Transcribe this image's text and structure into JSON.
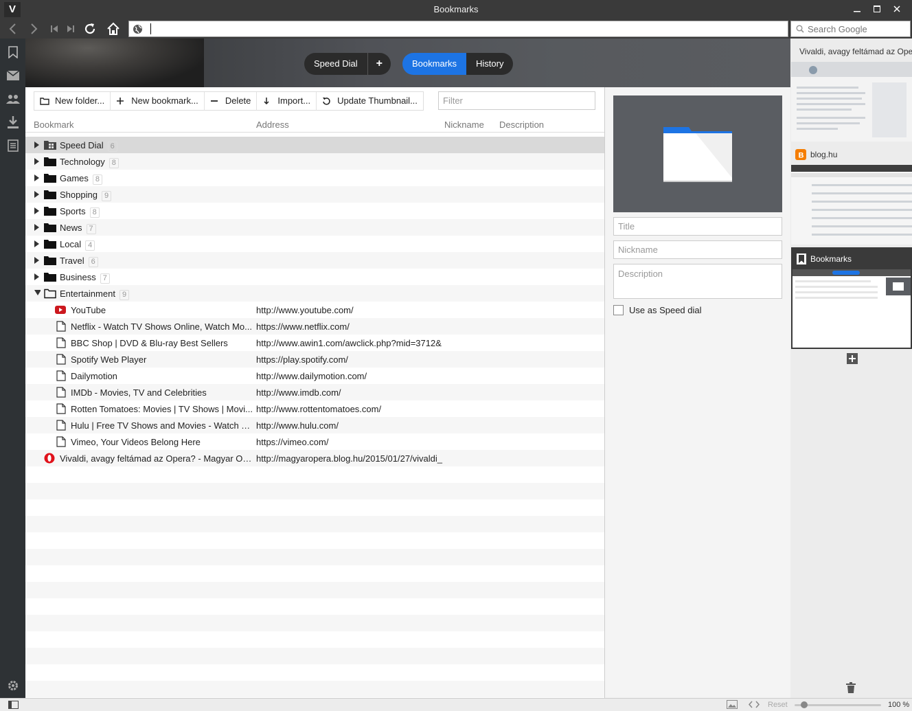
{
  "window": {
    "title": "Bookmarks"
  },
  "address": {
    "value": ""
  },
  "search": {
    "placeholder": "Search Google"
  },
  "header": {
    "speed_dial": "Speed Dial",
    "plus": "+",
    "bookmarks": "Bookmarks",
    "history": "History"
  },
  "toolbar": {
    "new_folder": "New folder...",
    "new_bookmark": "New bookmark...",
    "delete": "Delete",
    "import": "Import...",
    "update_thumbnail": "Update Thumbnail...",
    "filter_placeholder": "Filter"
  },
  "columns": {
    "bookmark": "Bookmark",
    "address": "Address",
    "nickname": "Nickname",
    "description": "Description"
  },
  "folders": [
    {
      "name": "Speed Dial",
      "count": "6"
    },
    {
      "name": "Technology",
      "count": "8"
    },
    {
      "name": "Games",
      "count": "8"
    },
    {
      "name": "Shopping",
      "count": "9"
    },
    {
      "name": "Sports",
      "count": "8"
    },
    {
      "name": "News",
      "count": "7"
    },
    {
      "name": "Local",
      "count": "4"
    },
    {
      "name": "Travel",
      "count": "6"
    },
    {
      "name": "Business",
      "count": "7"
    },
    {
      "name": "Entertainment",
      "count": "9"
    }
  ],
  "entertainment": [
    {
      "name": "YouTube",
      "address": "http://www.youtube.com/"
    },
    {
      "name": "Netflix - Watch TV Shows Online, Watch Mo...",
      "address": "https://www.netflix.com/"
    },
    {
      "name": "BBC Shop | DVD & Blu-ray Best Sellers",
      "address": "http://www.awin1.com/awclick.php?mid=3712&"
    },
    {
      "name": "Spotify Web Player",
      "address": "https://play.spotify.com/"
    },
    {
      "name": "Dailymotion",
      "address": "http://www.dailymotion.com/"
    },
    {
      "name": "IMDb - Movies, TV and Celebrities",
      "address": "http://www.imdb.com/"
    },
    {
      "name": "Rotten Tomatoes: Movies | TV Shows | Movi...",
      "address": "http://www.rottentomatoes.com/"
    },
    {
      "name": "Hulu | Free TV Shows and Movies - Watch Y...",
      "address": "http://www.hulu.com/"
    },
    {
      "name": "Vimeo, Your Videos Belong Here",
      "address": "https://vimeo.com/"
    }
  ],
  "root_bookmark": {
    "name": "Vivaldi, avagy feltámad az Opera? - Magyar Op...",
    "address": "http://magyaropera.blog.hu/2015/01/27/vivaldi_"
  },
  "detail": {
    "title_placeholder": "Title",
    "nickname_placeholder": "Nickname",
    "description_placeholder": "Description",
    "speed_dial_label": "Use as Speed dial"
  },
  "tabs": [
    {
      "title": "Vivaldi, avagy feltámad az Opera?"
    },
    {
      "title": "blog.hu"
    },
    {
      "title": "Bookmarks"
    }
  ],
  "status": {
    "reset": "Reset",
    "zoom": "100 %"
  },
  "colors": {
    "accent": "#1d74e4",
    "chrome": "#3a3a3a",
    "sidebar": "#2e3235",
    "opera_red": "#e0121b",
    "blogger_orange": "#f57d00",
    "youtube_red": "#cc181e"
  },
  "icons": {
    "folder": "folder-icon",
    "page": "page-icon",
    "speed_dial": "speed-dial-folder-icon"
  }
}
